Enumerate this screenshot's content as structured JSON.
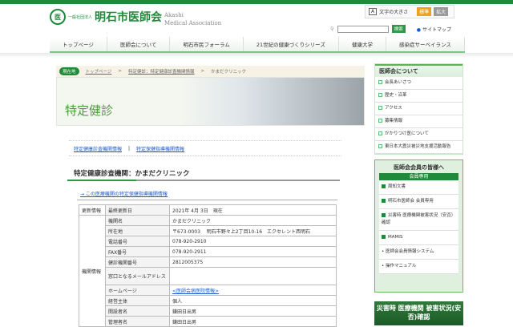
{
  "header": {
    "logo_mark": "医",
    "logo_prefix": "一般社団法人",
    "logo_name": "明石市医師会",
    "logo_en_1": "Akashi",
    "logo_en_2": "Medical Association",
    "fontsize_label": "文字の大きさ",
    "fontsize_standard": "標準",
    "fontsize_large": "拡大",
    "search_button": "検索",
    "sitemap": "サイトマップ",
    "search_value": ""
  },
  "nav": [
    "トップページ",
    "医師会について",
    "明石市民フォーラム",
    "21世紀の健康づくりシリーズ",
    "健康大学",
    "感染症サーベイランス"
  ],
  "breadcrumb": {
    "here": "現在地",
    "items": [
      "トップページ",
      "特定健診：特定健康診査機関情報",
      "かまだクリニック"
    ]
  },
  "banner_title": "特定健診",
  "sublinks": [
    "特定健康診査機関情報",
    "特定保健指導機関情報"
  ],
  "sublink_sep": "|",
  "heading": "特定健康診査機関：かまだクリニック",
  "guidance_link": "→ この医療機関の特定保健指導機関情報",
  "table": {
    "group1": "更新情報",
    "group2": "機関情報",
    "rows": [
      {
        "label": "最終更新日",
        "value": "2021年 4月 3日　現在"
      },
      {
        "label": "機関名",
        "value": "かまだクリニック"
      },
      {
        "label": "所在地",
        "value": "〒673-0003　 明石市野々上2丁目10-16　エクセレント西明石"
      },
      {
        "label": "電話番号",
        "value": "078-920-2910"
      },
      {
        "label": "FAX番号",
        "value": "078-920-2911"
      },
      {
        "label": "健診機関番号",
        "value": "2812005375"
      },
      {
        "label": "窓口となるメールアドレス",
        "value": ""
      },
      {
        "label": "ホームページ",
        "value": "<医師会病医院情報>"
      },
      {
        "label": "経営主体",
        "value": "個人"
      },
      {
        "label": "開設者名",
        "value": "鎌田日出男"
      },
      {
        "label": "管理者名",
        "value": "鎌田日出男"
      }
    ]
  },
  "sidebar": {
    "about_title": "医師会について",
    "about_items": [
      "会長あいさつ",
      "歴史・沿革",
      "アクセス",
      "募集情報",
      "かかりつけ医について",
      "東日本大震災被災地支援活動報告"
    ],
    "members_title": "医師会会員の皆様へ",
    "members_band": "会員専用",
    "members_items": [
      "周知文書",
      "明石市医師会 会員専用",
      "災害時 医療機関被害状況（安否）確認",
      "MAMIS"
    ],
    "members_sub": [
      "医師会会員情報システム",
      "操作マニュアル"
    ],
    "disaster_banner": "災害時 医療機関 被害状況(安否)確認"
  }
}
